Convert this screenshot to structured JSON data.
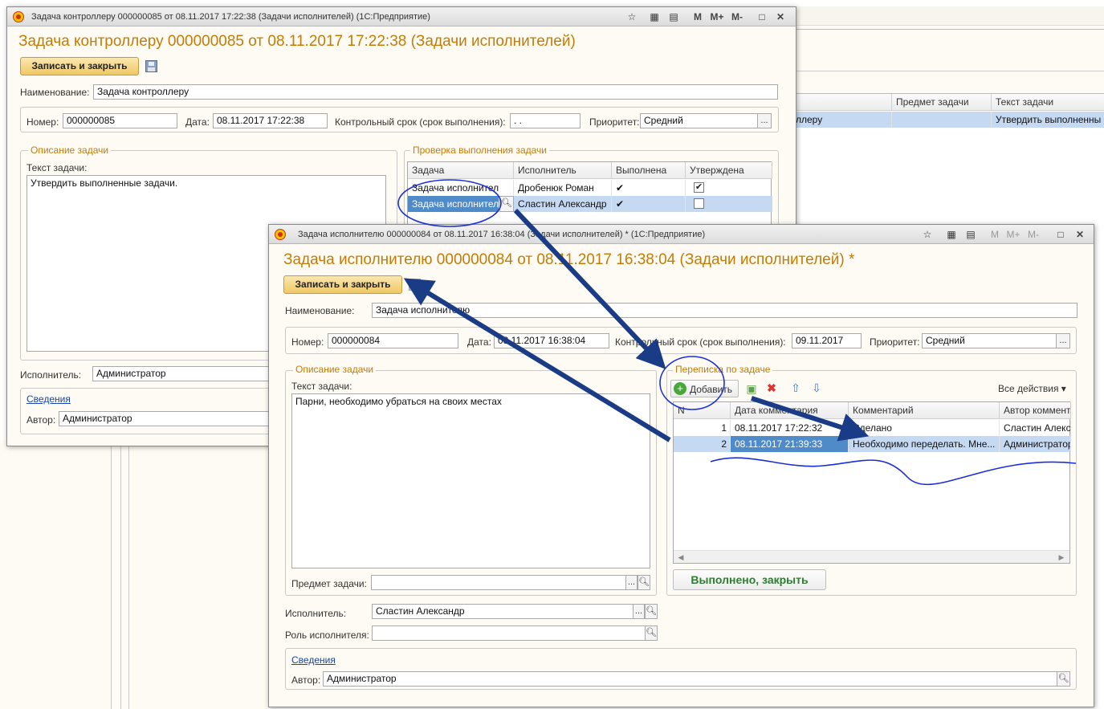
{
  "bgw": {
    "col1": "Предмет задачи",
    "col2": "Текст задачи",
    "row_c0": "ллеру",
    "row_c2": "Утвердить выполненны"
  },
  "w1": {
    "titlebar": "Задача контроллеру 000000085 от 08.11.2017 17:22:38 (Задачи исполнителей) (1С:Предприятие)",
    "tb_controls": [
      "M",
      "M+",
      "M-"
    ],
    "heading": "Задача контроллеру 000000085 от 08.11.2017 17:22:38 (Задачи исполнителей)",
    "save_close": "Записать и закрыть",
    "name_label": "Наименование:",
    "name_value": "Задача контроллеру",
    "number_label": "Номер:",
    "number_value": "000000085",
    "date_label": "Дата:",
    "date_value": "08.11.2017 17:22:38",
    "deadline_label": "Контрольный срок (срок выполнения):",
    "deadline_value": ". .",
    "priority_label": "Приоритет:",
    "priority_value": "Средний",
    "desc_group": "Описание задачи",
    "text_label": "Текст задачи:",
    "text_value": "Утвердить выполненные задачи.",
    "check_group": "Проверка выполнения задачи",
    "columns": [
      "Задача",
      "Исполнитель",
      "Выполнена",
      "Утверждена"
    ],
    "rows": [
      {
        "task": "Задача исполнител",
        "executor": "Дробенюк Роман",
        "done": "✔"
      },
      {
        "task": "Задача исполнител",
        "executor": "Сластин Александр",
        "done": "✔"
      }
    ],
    "executor_label": "Исполнитель:",
    "executor_value": "Администратор",
    "info_link": "Сведения",
    "author_label": "Автор:",
    "author_value": "Администратор"
  },
  "w2": {
    "titlebar": "Задача исполнителю 000000084 от 08.11.2017 16:38:04 (Задачи исполнителей) * (1С:Предприятие)",
    "tb_controls": [
      "M",
      "M+",
      "M-"
    ],
    "heading": "Задача исполнителю 000000084 от 08.11.2017 16:38:04 (Задачи исполнителей) *",
    "save_close": "Записать и закрыть",
    "name_label": "Наименование:",
    "name_value": "Задача исполнителю",
    "number_label": "Номер:",
    "number_value": "000000084",
    "date_label": "Дата:",
    "date_value": "08.11.2017 16:38:04",
    "deadline_label": "Контрольный срок (срок выполнения):",
    "deadline_value": "09.11.2017",
    "priority_label": "Приоритет:",
    "priority_value": "Средний",
    "desc_group": "Описание задачи",
    "text_label": "Текст задачи:",
    "text_value": "Парни, необходимо убраться на своих местах",
    "subject_label": "Предмет задачи:",
    "corr_group": "Переписка по задаче",
    "add_button": "Добавить",
    "all_actions": "Все действия ▾",
    "columns": [
      "N",
      "Дата комментария",
      "Комментарий",
      "Автор коммент"
    ],
    "rows": [
      {
        "n": "1",
        "date": "08.11.2017 17:22:32",
        "comment": "Сделано",
        "author": "Сластин Алекс"
      },
      {
        "n": "2",
        "date": "08.11.2017 21:39:33",
        "comment": "Необходимо переделать. Мне...",
        "author": "Администратор"
      }
    ],
    "done_close": "Выполнено, закрыть",
    "executor_label": "Исполнитель:",
    "executor_value": "Сластин Александр",
    "role_label": "Роль исполнителя:",
    "info_link": "Сведения",
    "author_label": "Автор:",
    "author_value": "Администратор"
  },
  "colors": {
    "title": "#c47c06",
    "annotation": "#1a3c87",
    "pen": "#1c2fd6",
    "selection": "#4f8ac9"
  }
}
